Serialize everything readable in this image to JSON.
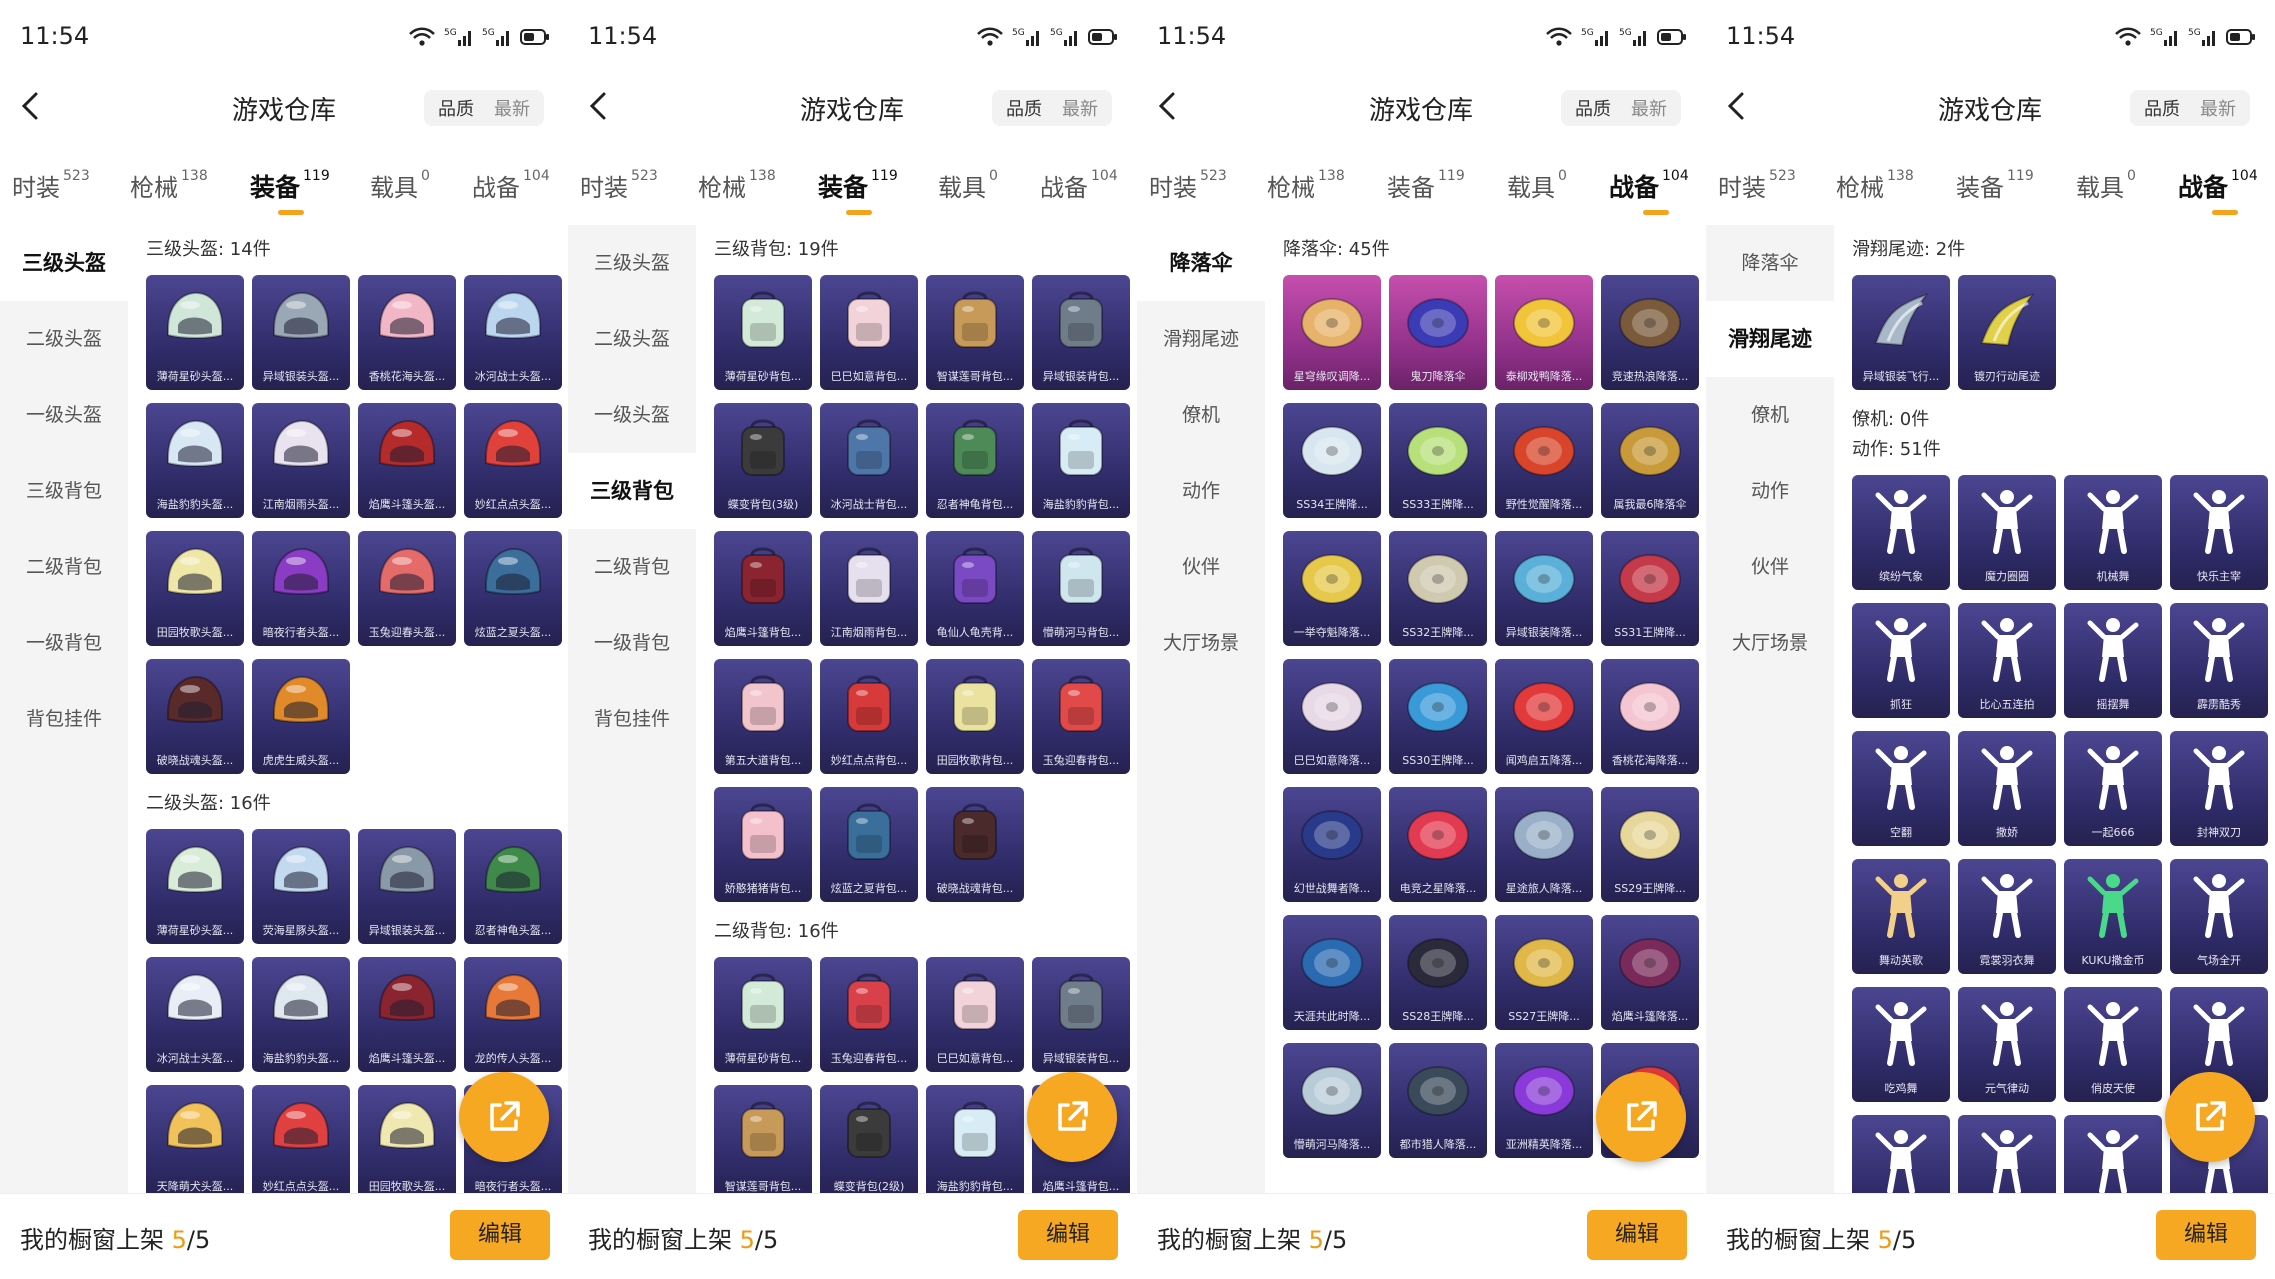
{
  "status": {
    "time": "11:54"
  },
  "header": {
    "title": "游戏仓库",
    "sort_quality": "品质",
    "sort_newest": "最新"
  },
  "tabs": [
    {
      "label": "时装",
      "count": "523"
    },
    {
      "label": "枪械",
      "count": "138"
    },
    {
      "label": "装备",
      "count": "119"
    },
    {
      "label": "载具",
      "count": "0"
    },
    {
      "label": "战备",
      "count": "104"
    }
  ],
  "bottom": {
    "prefix": "我的橱窗上架 ",
    "current": "5",
    "total": "/5",
    "edit": "编辑"
  },
  "colors": {
    "accent": "#f7a823",
    "tile": "#3a357a",
    "tile_pink": "#a63c9a"
  },
  "screens": [
    {
      "active_tab": 2,
      "nav": [
        "三级头盔",
        "二级头盔",
        "一级头盔",
        "三级背包",
        "二级背包",
        "一级背包",
        "背包挂件"
      ],
      "active_nav": 0,
      "sections": [
        {
          "title": "三级头盔: 14件",
          "items": [
            {
              "label": "薄荷星砂头盔...",
              "icon": "helmet-icon",
              "color": "#cfe6d9"
            },
            {
              "label": "异域银装头盔...",
              "icon": "helmet-icon",
              "color": "#9aa7b4"
            },
            {
              "label": "香桃花海头盔...",
              "icon": "helmet-icon",
              "color": "#f1b7c6"
            },
            {
              "label": "冰河战士头盔...",
              "icon": "helmet-icon",
              "color": "#bcd6ef"
            },
            {
              "label": "海盐豹豹头盔...",
              "icon": "helmet-icon",
              "color": "#d7e7f4"
            },
            {
              "label": "江南烟雨头盔...",
              "icon": "helmet-icon",
              "color": "#e9e3ef"
            },
            {
              "label": "焰鹰斗篷头盔...",
              "icon": "helmet-icon",
              "color": "#b52a2a"
            },
            {
              "label": "妙红点点头盔...",
              "icon": "helmet-icon",
              "color": "#e0413a"
            },
            {
              "label": "田园牧歌头盔...",
              "icon": "helmet-icon",
              "color": "#efe7a8"
            },
            {
              "label": "暗夜行者头盔...",
              "icon": "helmet-icon",
              "color": "#8b3cc4"
            },
            {
              "label": "玉兔迎春头盔...",
              "icon": "helmet-icon",
              "color": "#e56a6a"
            },
            {
              "label": "炫蓝之夏头盔...",
              "icon": "helmet-icon",
              "color": "#3c6e9c"
            },
            {
              "label": "破晓战魂头盔...",
              "icon": "helmet-icon",
              "color": "#5a2a2a"
            },
            {
              "label": "虎虎生威头盔...",
              "icon": "helmet-icon",
              "color": "#e08a2a"
            }
          ]
        },
        {
          "title": "二级头盔: 16件",
          "items": [
            {
              "label": "薄荷星砂头盔...",
              "icon": "helmet-icon",
              "color": "#d9ecd9"
            },
            {
              "label": "荧海星豚头盔...",
              "icon": "helmet-icon",
              "color": "#c3d9f0"
            },
            {
              "label": "异域银装头盔...",
              "icon": "helmet-icon",
              "color": "#8a99a8"
            },
            {
              "label": "忍者神龟头盔...",
              "icon": "helmet-icon",
              "color": "#3f8a4a"
            },
            {
              "label": "冰河战士头盔...",
              "icon": "helmet-icon",
              "color": "#e9eef6"
            },
            {
              "label": "海盐豹豹头盔...",
              "icon": "helmet-icon",
              "color": "#dfe8ef"
            },
            {
              "label": "焰鹰斗篷头盔...",
              "icon": "helmet-icon",
              "color": "#8a2430"
            },
            {
              "label": "龙的传人头盔...",
              "icon": "helmet-icon",
              "color": "#e87838"
            },
            {
              "label": "天降萌犬头盔...",
              "icon": "helmet-icon",
              "color": "#f2c25a"
            },
            {
              "label": "妙红点点头盔...",
              "icon": "helmet-icon",
              "color": "#e04040"
            },
            {
              "label": "田园牧歌头盔...",
              "icon": "helmet-icon",
              "color": "#efe8b0"
            },
            {
              "label": "暗夜行者头盔...",
              "icon": "helmet-icon",
              "color": "#6a3aa6"
            }
          ]
        }
      ]
    },
    {
      "active_tab": 2,
      "nav": [
        "三级头盔",
        "二级头盔",
        "一级头盔",
        "三级背包",
        "二级背包",
        "一级背包",
        "背包挂件"
      ],
      "active_nav": 3,
      "sections": [
        {
          "title": "三级背包: 19件",
          "items": [
            {
              "label": "薄荷星砂背包...",
              "icon": "backpack-icon",
              "color": "#d4ead8"
            },
            {
              "label": "巳巳如意背包...",
              "icon": "backpack-icon",
              "color": "#f2d3da"
            },
            {
              "label": "智谋莲哥背包...",
              "icon": "backpack-icon",
              "color": "#c79a5a"
            },
            {
              "label": "异域银装背包...",
              "icon": "backpack-icon",
              "color": "#6f7c8a"
            },
            {
              "label": "蝶变背包(3级)",
              "icon": "backpack-icon",
              "color": "#3b3b3b"
            },
            {
              "label": "冰河战士背包...",
              "icon": "backpack-icon",
              "color": "#4f76a8"
            },
            {
              "label": "忍者神龟背包...",
              "icon": "backpack-icon",
              "color": "#4d8a58"
            },
            {
              "label": "海盐豹豹背包...",
              "icon": "backpack-icon",
              "color": "#d8ecf5"
            },
            {
              "label": "焰鹰斗篷背包...",
              "icon": "backpack-icon",
              "color": "#8a2430"
            },
            {
              "label": "江南烟雨背包...",
              "icon": "backpack-icon",
              "color": "#e6e0ee"
            },
            {
              "label": "龟仙人龟壳背...",
              "icon": "backpack-icon",
              "color": "#7a4ac4"
            },
            {
              "label": "懵萌河马背包...",
              "icon": "backpack-icon",
              "color": "#cfe6ef"
            },
            {
              "label": "第五大道背包...",
              "icon": "backpack-icon",
              "color": "#f2c4cc"
            },
            {
              "label": "妙红点点背包...",
              "icon": "backpack-icon",
              "color": "#d63a3a"
            },
            {
              "label": "田园牧歌背包...",
              "icon": "backpack-icon",
              "color": "#ece2a0"
            },
            {
              "label": "玉兔迎春背包...",
              "icon": "backpack-icon",
              "color": "#e24a4a"
            },
            {
              "label": "娇憨猪猪背包...",
              "icon": "backpack-icon",
              "color": "#f3c0cc"
            },
            {
              "label": "炫蓝之夏背包...",
              "icon": "backpack-icon",
              "color": "#3a6f9c"
            },
            {
              "label": "破晓战魂背包...",
              "icon": "backpack-icon",
              "color": "#4a2a2a"
            }
          ]
        },
        {
          "title": "二级背包: 16件",
          "items": [
            {
              "label": "薄荷星砂背包...",
              "icon": "backpack-icon",
              "color": "#d4ead8"
            },
            {
              "label": "玉兔迎春背包...",
              "icon": "backpack-icon",
              "color": "#d8414a"
            },
            {
              "label": "巳巳如意背包...",
              "icon": "backpack-icon",
              "color": "#f2d3da"
            },
            {
              "label": "异域银装背包...",
              "icon": "backpack-icon",
              "color": "#6f7c8a"
            },
            {
              "label": "智谋莲哥背包...",
              "icon": "backpack-icon",
              "color": "#c79a5a"
            },
            {
              "label": "蝶变背包(2级)",
              "icon": "backpack-icon",
              "color": "#3b3b3b"
            },
            {
              "label": "海盐豹豹背包...",
              "icon": "backpack-icon",
              "color": "#d8ecf5"
            },
            {
              "label": "焰鹰斗篷背包...",
              "icon": "backpack-icon",
              "color": "#8a2430"
            }
          ]
        }
      ]
    },
    {
      "active_tab": 4,
      "nav": [
        "降落伞",
        "滑翔尾迹",
        "僚机",
        "动作",
        "伙伴",
        "大厅场景"
      ],
      "active_nav": 0,
      "sections": [
        {
          "title": "降落伞: 45件",
          "items": [
            {
              "label": "星穹缘叹调降...",
              "icon": "parachute-icon",
              "color": "#e7b26a",
              "pink": true
            },
            {
              "label": "鬼刀降落伞",
              "icon": "parachute-icon",
              "color": "#3b3bb5",
              "pink": true
            },
            {
              "label": "泰柳戏鸭降落...",
              "icon": "parachute-icon",
              "color": "#f1c43a",
              "pink": true
            },
            {
              "label": "竞速热浪降落...",
              "icon": "parachute-icon",
              "color": "#7a5a3a"
            },
            {
              "label": "SS34王牌降...",
              "icon": "parachute-icon",
              "color": "#d8e6ef"
            },
            {
              "label": "SS33王牌降...",
              "icon": "parachute-icon",
              "color": "#b8e07a"
            },
            {
              "label": "野性觉醒降落...",
              "icon": "parachute-icon",
              "color": "#d8452a"
            },
            {
              "label": "属我最6降落伞",
              "icon": "parachute-icon",
              "color": "#c89a3a"
            },
            {
              "label": "一举夺魁降落...",
              "icon": "parachute-icon",
              "color": "#e6c84a"
            },
            {
              "label": "SS32王牌降...",
              "icon": "parachute-icon",
              "color": "#cfc9b0"
            },
            {
              "label": "异域银装降落...",
              "icon": "parachute-icon",
              "color": "#5ab0d8"
            },
            {
              "label": "SS31王牌降...",
              "icon": "parachute-icon",
              "color": "#c43a4a"
            },
            {
              "label": "巳巳如意降落...",
              "icon": "parachute-icon",
              "color": "#e7d9e6"
            },
            {
              "label": "SS30王牌降...",
              "icon": "parachute-icon",
              "color": "#3a9ad8"
            },
            {
              "label": "闻鸡启五降落...",
              "icon": "parachute-icon",
              "color": "#e23a3a"
            },
            {
              "label": "香桃花海降落...",
              "icon": "parachute-icon",
              "color": "#f4c6d2"
            },
            {
              "label": "幻世战舞者降...",
              "icon": "parachute-icon",
              "color": "#2a3a8a"
            },
            {
              "label": "电竞之星降落...",
              "icon": "parachute-icon",
              "color": "#e23a50"
            },
            {
              "label": "星途旅人降落...",
              "icon": "parachute-icon",
              "color": "#9ab0c8"
            },
            {
              "label": "SS29王牌降...",
              "icon": "parachute-icon",
              "color": "#e8d79a"
            },
            {
              "label": "天涯共此时降...",
              "icon": "parachute-icon",
              "color": "#2a6ab0"
            },
            {
              "label": "SS28王牌降...",
              "icon": "parachute-icon",
              "color": "#2a2a3a"
            },
            {
              "label": "SS27王牌降...",
              "icon": "parachute-icon",
              "color": "#e0b84a"
            },
            {
              "label": "焰鹰斗篷降落...",
              "icon": "parachute-icon",
              "color": "#7a2a5a"
            },
            {
              "label": "懵萌河马降落...",
              "icon": "parachute-icon",
              "color": "#b8ccd8"
            },
            {
              "label": "都市猎人降落...",
              "icon": "parachute-icon",
              "color": "#3a4a5a"
            },
            {
              "label": "亚洲精英降落...",
              "icon": "parachute-icon",
              "color": "#8a3ad8"
            },
            {
              "label": "",
              "icon": "parachute-icon",
              "color": "#e23a3a"
            }
          ]
        }
      ]
    },
    {
      "active_tab": 4,
      "nav": [
        "降落伞",
        "滑翔尾迹",
        "僚机",
        "动作",
        "伙伴",
        "大厅场景"
      ],
      "active_nav": 1,
      "sections": [
        {
          "title": "滑翔尾迹: 2件",
          "items": [
            {
              "label": "异域银装飞行...",
              "icon": "glide-trail-icon",
              "color": "#a8b8c8"
            },
            {
              "label": "镀刃行动尾迹",
              "icon": "glide-trail-icon",
              "color": "#e0d04a"
            }
          ]
        },
        {
          "title": "僚机: 0件",
          "items": []
        },
        {
          "title": "动作: 51件",
          "items": [
            {
              "label": "缤纷气象",
              "icon": "emote-figure-icon",
              "color": "#ffffff"
            },
            {
              "label": "魔力圈圈",
              "icon": "emote-figure-icon",
              "color": "#ffffff"
            },
            {
              "label": "机械舞",
              "icon": "emote-figure-icon",
              "color": "#ffffff"
            },
            {
              "label": "快乐主宰",
              "icon": "emote-figure-icon",
              "color": "#ffffff"
            },
            {
              "label": "抓狂",
              "icon": "emote-figure-icon",
              "color": "#ffffff"
            },
            {
              "label": "比心五连拍",
              "icon": "emote-figure-icon",
              "color": "#ffffff"
            },
            {
              "label": "摇摆舞",
              "icon": "emote-figure-icon",
              "color": "#ffffff"
            },
            {
              "label": "霹雳酷秀",
              "icon": "emote-figure-icon",
              "color": "#ffffff"
            },
            {
              "label": "空翻",
              "icon": "emote-figure-icon",
              "color": "#ffffff"
            },
            {
              "label": "撒娇",
              "icon": "emote-figure-icon",
              "color": "#ffffff"
            },
            {
              "label": "一起666",
              "icon": "emote-figure-icon",
              "color": "#ffffff"
            },
            {
              "label": "封神双刀",
              "icon": "emote-figure-icon",
              "color": "#ffffff"
            },
            {
              "label": "舞动英歌",
              "icon": "emote-figure-icon",
              "color": "#f2d08a"
            },
            {
              "label": "霓裳羽衣舞",
              "icon": "emote-figure-icon",
              "color": "#ffffff"
            },
            {
              "label": "KUKU撒金币",
              "icon": "emote-figure-icon",
              "color": "#4ad88a"
            },
            {
              "label": "气场全开",
              "icon": "emote-figure-icon",
              "color": "#ffffff"
            },
            {
              "label": "吃鸡舞",
              "icon": "emote-figure-icon",
              "color": "#ffffff"
            },
            {
              "label": "元气律动",
              "icon": "emote-figure-icon",
              "color": "#ffffff"
            },
            {
              "label": "俏皮天使",
              "icon": "emote-figure-icon",
              "color": "#ffffff"
            },
            {
              "label": "",
              "icon": "emote-figure-icon",
              "color": "#ffffff"
            },
            {
              "label": "",
              "icon": "emote-figure-icon",
              "color": "#ffffff"
            },
            {
              "label": "",
              "icon": "emote-figure-icon",
              "color": "#ffffff"
            },
            {
              "label": "",
              "icon": "emote-figure-icon",
              "color": "#ffffff"
            },
            {
              "label": "",
              "icon": "emote-figure-icon",
              "color": "#ffffff"
            }
          ]
        }
      ]
    }
  ]
}
